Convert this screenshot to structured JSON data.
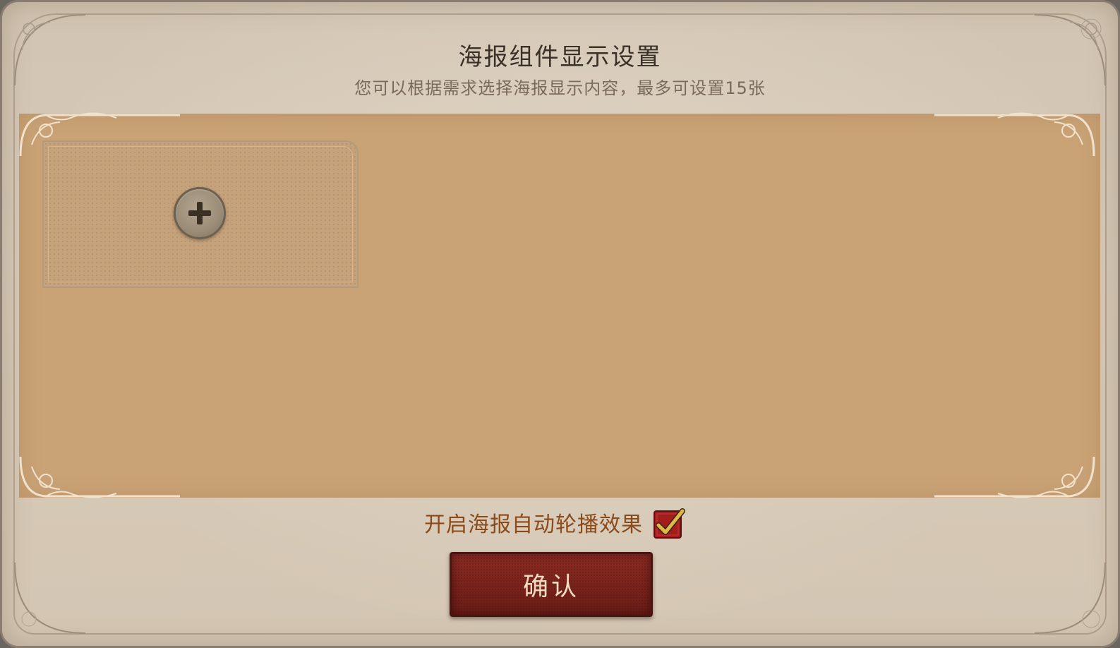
{
  "dialog": {
    "title": "海报组件显示设置",
    "subtitle": "您可以根据需求选择海报显示内容，最多可设置15张"
  },
  "poster_slots": {
    "add_icon": "plus-icon"
  },
  "autoplay": {
    "label": "开启海报自动轮播效果",
    "checked": true,
    "check_icon": "checkmark-icon"
  },
  "confirm_button": {
    "label": "确认"
  },
  "colors": {
    "content_bg": "#c9a275",
    "confirm_bg": "#7a231c",
    "autoplay_text": "#8a4a1a",
    "checkbox_bg": "#a31d1d",
    "checkmark": "#e0b84a"
  }
}
